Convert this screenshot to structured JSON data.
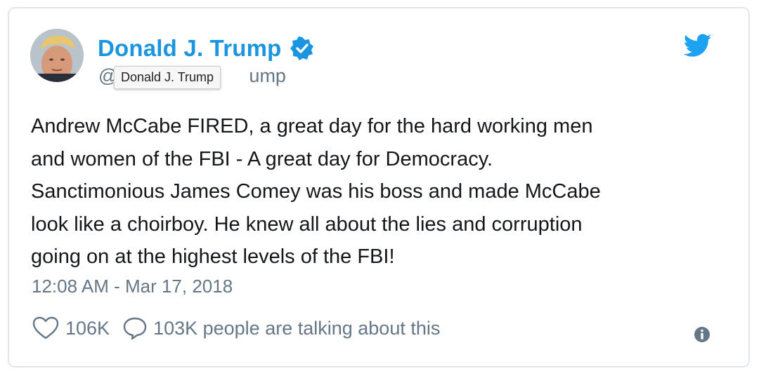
{
  "tweet": {
    "author_name": "Donald J. Trump",
    "handle_prefix": "@",
    "handle_visible": "ump",
    "tooltip": "Donald J. Trump",
    "text_lines": [
      "Andrew McCabe FIRED, a great day for the hard working men",
      "and women of the FBI - A great day for Democracy.",
      "Sanctimonious James Comey was his boss and made McCabe",
      "look like a choirboy. He knew all about the lies and corruption",
      "going on at the highest levels of the FBI!"
    ],
    "timestamp": "12:08 AM - Mar 17, 2018",
    "likes": "106K",
    "replies_text": "103K people are talking about this"
  },
  "icons": {
    "verified": "verified-badge-icon",
    "brand": "twitter-bird-icon",
    "like": "heart-icon",
    "reply": "speech-bubble-icon",
    "info": "info-icon"
  },
  "colors": {
    "accent": "#1b95e0",
    "text": "#14171a",
    "muted": "#657786",
    "border": "#e1e8ed"
  }
}
